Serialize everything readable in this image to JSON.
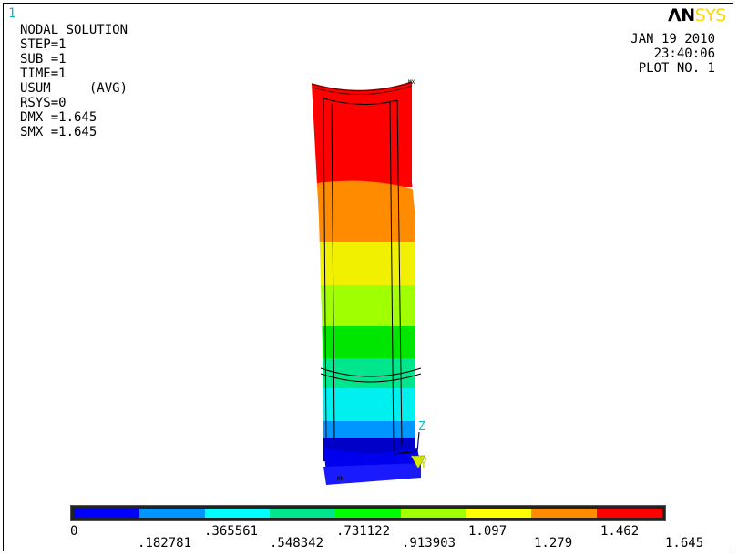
{
  "window_number": "1",
  "logo": {
    "an": "ΛN",
    "sys": "SYS"
  },
  "info_lines": [
    "NODAL SOLUTION",
    "",
    "STEP=1",
    "SUB =1",
    "TIME=1",
    "USUM     (AVG)",
    "RSYS=0",
    "DMX =1.645",
    "SMX =1.645"
  ],
  "stamp": {
    "date": "JAN 19 2010",
    "time": "23:40:06",
    "plot": "PLOT NO.   1"
  },
  "annotations": {
    "max_label": "MX",
    "min_label": "MN",
    "axis_z": "Z",
    "axis_y": "Y"
  },
  "legend": {
    "colors": [
      "#0000ff",
      "#0096ff",
      "#00ffff",
      "#00e68c",
      "#00ff00",
      "#a0ff00",
      "#ffff00",
      "#ff8c00",
      "#ff0000"
    ],
    "labels_top": [
      "0",
      ".365561",
      ".731122",
      "1.097",
      "1.462"
    ],
    "labels_bottom": [
      ".182781",
      ".548342",
      ".913903",
      "1.279",
      "1.645"
    ]
  }
}
